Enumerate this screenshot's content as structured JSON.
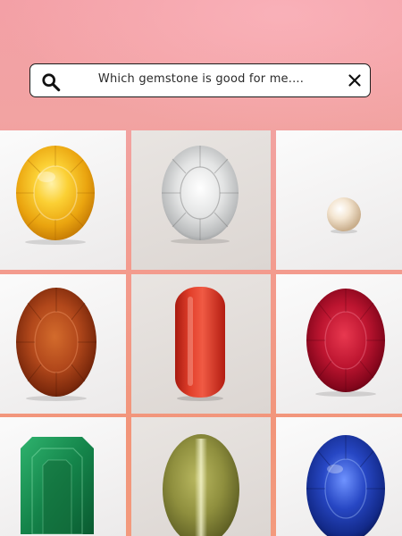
{
  "search": {
    "placeholder": "Which gemstone is good for me....",
    "search_icon": "search-icon",
    "clear_icon": "close-icon"
  },
  "colors": {
    "background_top": "#f3a0a6",
    "background_bottom": "#f2957a",
    "search_border": "#1c1c1c"
  },
  "gemstones": [
    {
      "gem": "yellow-sapphire",
      "color": "#f2b51e"
    },
    {
      "gem": "white-sapphire",
      "color": "#d9dadb"
    },
    {
      "gem": "pearl",
      "color": "#f1e2cf"
    },
    {
      "gem": "hessonite",
      "color": "#a6401b"
    },
    {
      "gem": "red-coral",
      "color": "#d83020"
    },
    {
      "gem": "ruby",
      "color": "#b5122d"
    },
    {
      "gem": "emerald",
      "color": "#17864a"
    },
    {
      "gem": "cats-eye",
      "color": "#8f8f3e"
    },
    {
      "gem": "blue-sapphire",
      "color": "#1d3fb6"
    }
  ]
}
